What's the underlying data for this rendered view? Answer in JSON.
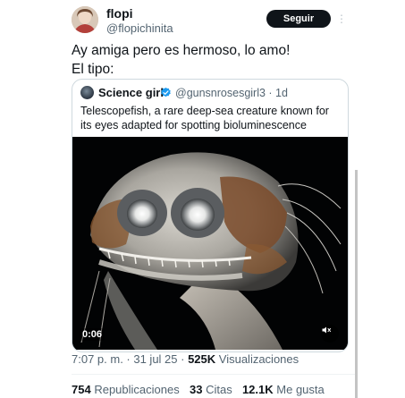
{
  "tweet": {
    "author": {
      "display_name": "flopi",
      "handle": "@flopichinita"
    },
    "follow_label": "Seguir",
    "more_label": "⋮",
    "text_line1": "Ay amiga pero es hermoso, lo amo!",
    "text_line2": "El tipo:",
    "quoted": {
      "display_name": "Science girl",
      "handle_time": "@gunsnrosesgirl3 · 1d",
      "text_line1": "Telescopefish, a rare deep-sea creature known for",
      "text_line2": "its eyes adapted for spotting bioluminescence",
      "video_duration": "0:06"
    },
    "meta": {
      "timestamp": "7:07 p. m. · 31 jul 25 · ",
      "views_count": "525K",
      "views_label": " Visualizaciones"
    },
    "stats": {
      "reposts_count": "754",
      "reposts_label": "Republicaciones",
      "quotes_count": "33",
      "quotes_label": "Citas",
      "likes_count": "12.1K",
      "likes_label": "Me gusta"
    }
  },
  "colors": {
    "text_primary": "#0f1419",
    "text_secondary": "#536471",
    "verified_blue": "#1d9bf0",
    "border": "#cfd9de"
  },
  "icons": {
    "verified": "verified-badge-icon",
    "mute": "speaker-muted-icon",
    "more": "vertical-dots-icon"
  }
}
